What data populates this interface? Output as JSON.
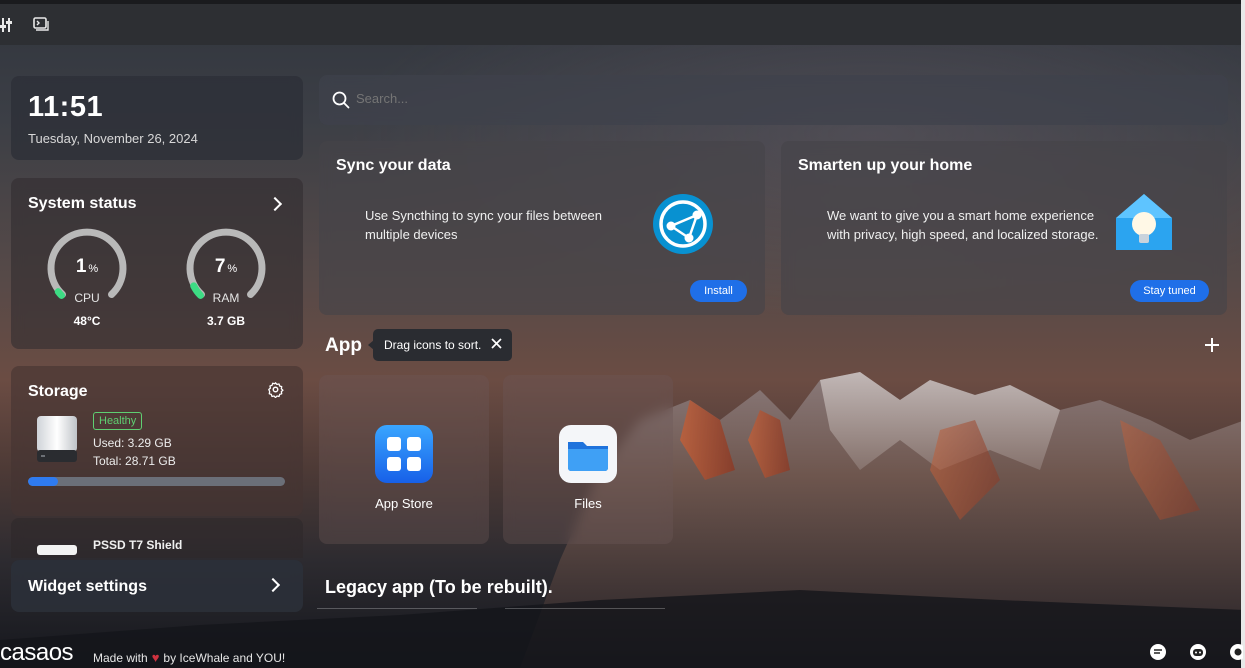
{
  "clock": {
    "time": "11:51",
    "date": "Tuesday, November 26, 2024"
  },
  "system_status": {
    "title": "System status",
    "cpu": {
      "value": "1",
      "unit": "%",
      "label": "CPU",
      "sub": "48°C",
      "percent": 1
    },
    "ram": {
      "value": "7",
      "unit": "%",
      "label": "RAM",
      "sub": "3.7 GB",
      "percent": 7
    }
  },
  "storage": {
    "title": "Storage",
    "health": "Healthy",
    "used": "Used: 3.29 GB",
    "total": "Total: 28.71 GB",
    "used_fraction": 0.115,
    "second_disk": "PSSD T7 Shield"
  },
  "widget_settings": {
    "label": "Widget settings"
  },
  "search": {
    "placeholder": "Search..."
  },
  "promos": [
    {
      "title": "Sync your data",
      "description": "Use Syncthing to sync your files between multiple devices",
      "button": "Install",
      "icon": "syncthing-icon"
    },
    {
      "title": "Smarten up your home",
      "description": "We want to give you a smart home experience with privacy, high speed, and localized storage.",
      "button": "Stay tuned",
      "icon": "smart-home-icon"
    }
  ],
  "apps_section": {
    "title": "App",
    "tooltip": "Drag icons to sort.",
    "apps": [
      {
        "label": "App Store",
        "icon": "app-store-icon"
      },
      {
        "label": "Files",
        "icon": "files-icon"
      }
    ]
  },
  "legacy_section": {
    "title": "Legacy app (To be rebuilt)."
  },
  "footer": {
    "logo": "casaos",
    "made_with": "Made with",
    "by": "by IceWhale and YOU!"
  },
  "colors": {
    "accent": "#1f6fe8",
    "healthy": "#5fcf72",
    "gauge_green": "#3ddc84",
    "gauge_track": "#b9b9b9"
  }
}
